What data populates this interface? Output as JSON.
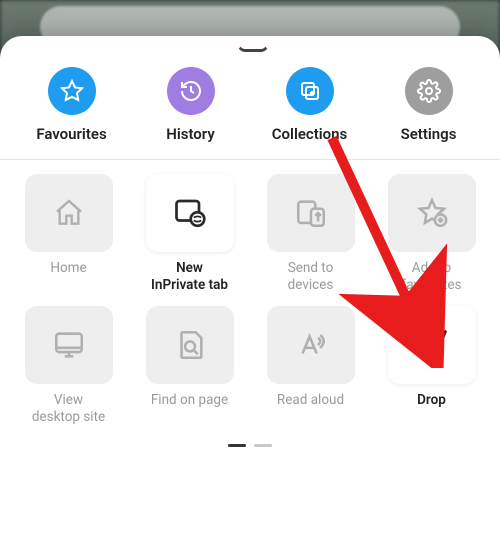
{
  "colors": {
    "favourites": "#1e9cf0",
    "history": "#9f7de2",
    "collections": "#1e9cf0",
    "settings": "#9e9e9e"
  },
  "quick": {
    "favourites": "Favourites",
    "history": "History",
    "collections": "Collections",
    "settings": "Settings"
  },
  "tiles": {
    "home": "Home",
    "newInprivate": "New\nInPrivate tab",
    "sendDevices": "Send to\ndevices",
    "addFavourites": "Add to\nfavourites",
    "viewDesktop": "View\ndesktop site",
    "findOnPage": "Find on page",
    "readAloud": "Read aloud",
    "drop": "Drop"
  }
}
